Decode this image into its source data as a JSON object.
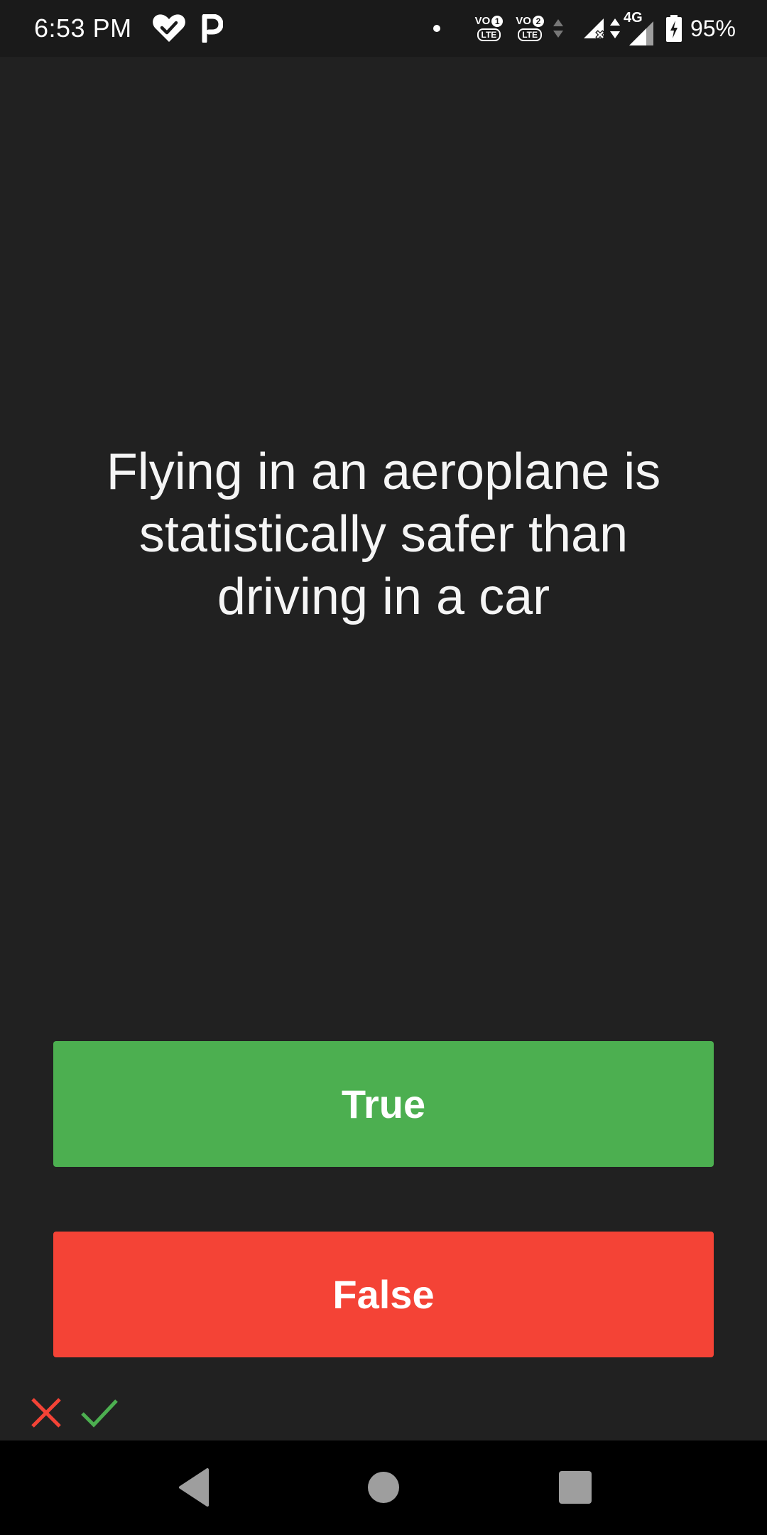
{
  "status_bar": {
    "time": "6:53 PM",
    "icons": [
      "heart-check-icon",
      "parking-icon",
      "dot-icon",
      "volte-1-icon",
      "volte-2-icon",
      "data-arrows-icon",
      "signal-no-service-icon",
      "4g-signal-icon",
      "battery-charging-icon"
    ],
    "volte1": {
      "vo": "VO",
      "num": "1",
      "lte": "LTE"
    },
    "volte2": {
      "vo": "VO",
      "num": "2",
      "lte": "LTE"
    },
    "network": "4G",
    "battery": "95%"
  },
  "quiz": {
    "question": "Flying in an aeroplane is statistically safer than driving in a car",
    "true_label": "True",
    "false_label": "False"
  },
  "score": {
    "icons": [
      "wrong-x-icon",
      "correct-check-icon"
    ]
  },
  "colors": {
    "background": "#212121",
    "true": "#4caf50",
    "false": "#f44336"
  },
  "nav": {
    "icons": [
      "back-icon",
      "home-icon",
      "recents-icon"
    ]
  }
}
